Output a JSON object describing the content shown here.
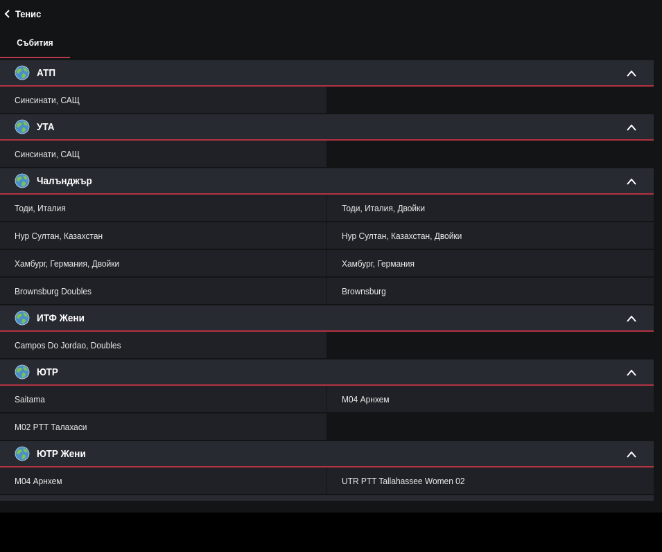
{
  "header": {
    "title": "Тенис",
    "back_icon": "chevron-left-icon"
  },
  "tabs": [
    {
      "label": "Събития",
      "active": true
    }
  ],
  "colors": {
    "accent": "#b23342",
    "section_bg": "#272a31",
    "row_bg": "#1f2126",
    "page_bg": "#131416"
  },
  "sections": [
    {
      "title": "АТП",
      "icon": "globe-icon",
      "expanded": true,
      "rows": [
        [
          "Синсинати, САЩ",
          null
        ]
      ]
    },
    {
      "title": "УТА",
      "icon": "globe-icon",
      "expanded": true,
      "rows": [
        [
          "Синсинати, САЩ",
          null
        ]
      ]
    },
    {
      "title": "Чалънджър",
      "icon": "globe-icon",
      "expanded": true,
      "rows": [
        [
          "Тоди, Италия",
          "Тоди, Италия, Двойки"
        ],
        [
          "Нур Султан, Казахстан",
          "Нур Султан, Казахстан, Двойки"
        ],
        [
          "Хамбург, Германия, Двойки",
          "Хамбург, Германия"
        ],
        [
          "Brownsburg Doubles",
          "Brownsburg"
        ]
      ]
    },
    {
      "title": "ИТФ Жени",
      "icon": "globe-icon",
      "expanded": true,
      "rows": [
        [
          "Campos Do Jordao, Doubles",
          null
        ]
      ]
    },
    {
      "title": "ЮТР",
      "icon": "globe-icon",
      "expanded": true,
      "rows": [
        [
          "Saitama",
          "M04 Арнхем"
        ],
        [
          "M02 PTT Талахаси",
          null
        ]
      ]
    },
    {
      "title": "ЮТР Жени",
      "icon": "globe-icon",
      "expanded": true,
      "rows": [
        [
          "M04 Арнхем",
          "UTR PTT Tallahassee Women 02"
        ]
      ]
    }
  ]
}
